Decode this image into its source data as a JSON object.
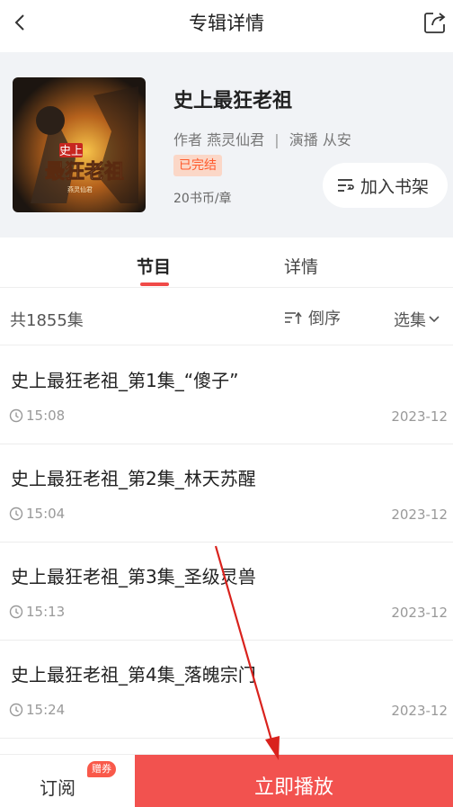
{
  "header": {
    "title": "专辑详情"
  },
  "album": {
    "title": "史上最狂老祖",
    "author_label": "作者",
    "author": "燕灵仙君",
    "narrator_label": "演播",
    "narrator": "从安",
    "status": "已完结",
    "price": "20书币/章",
    "add_shelf": "加入书架",
    "cover_text_top": "史上",
    "cover_text_main": "最狂老祖",
    "cover_text_small": "燕灵仙君"
  },
  "tabs": [
    {
      "label": "节目"
    },
    {
      "label": "详情"
    }
  ],
  "list": {
    "count": "共1855集",
    "sort": "倒序",
    "select": "选集"
  },
  "episodes": [
    {
      "title": "史上最狂老祖_第1集_“傻子”",
      "duration": "15:08",
      "date": "2023-12"
    },
    {
      "title": "史上最狂老祖_第2集_林天苏醒",
      "duration": "15:04",
      "date": "2023-12"
    },
    {
      "title": "史上最狂老祖_第3集_圣级灵兽",
      "duration": "15:13",
      "date": "2023-12"
    },
    {
      "title": "史上最狂老祖_第4集_落魄宗门",
      "duration": "15:24",
      "date": "2023-12"
    }
  ],
  "bottom": {
    "subscribe": "订阅",
    "gift_badge": "赠券",
    "play_now": "立即播放"
  },
  "colors": {
    "accent": "#f2524f",
    "status_badge_bg": "#fbd7c7",
    "status_badge_text": "#ff5a2c",
    "annotation_arrow": "#d9221d"
  }
}
